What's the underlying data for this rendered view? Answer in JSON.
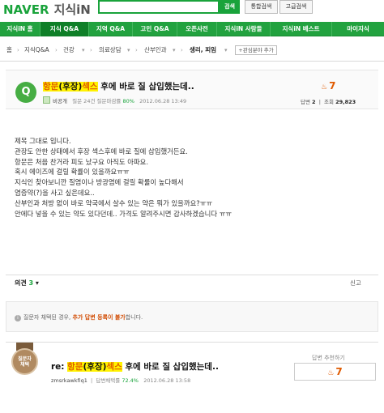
{
  "header": {
    "logo_naver": "NAVER",
    "logo_kin": "지식iN",
    "search_value": "",
    "search_button": "검색",
    "integrated_search": "통합검색",
    "advanced_search": "고급검색"
  },
  "nav": {
    "items": [
      {
        "label": "지식iN 홈"
      },
      {
        "label": "지식 Q&A"
      },
      {
        "label": "지역 Q&A"
      },
      {
        "label": "고민 Q&A"
      },
      {
        "label": "오픈사전"
      },
      {
        "label": "지식iN 사람들"
      },
      {
        "label": "지식iN 베스트"
      },
      {
        "label": "마이지식"
      }
    ],
    "active_index": 1
  },
  "breadcrumb": {
    "items": [
      "홈",
      "지식Q&A",
      "건강",
      "의료상담",
      "산부인과",
      "생리, 피임"
    ],
    "interest_button": "관심분야 추가"
  },
  "question": {
    "badge": "Q",
    "title_parts": [
      "항문",
      "(후장)",
      "섹스",
      " 후에 바로 질 삽입했는데.."
    ],
    "author": "비공개",
    "meta_prefix": "질문 24건 질문마감률",
    "close_rate": "80%",
    "date": "2012.06.28 13:49",
    "recommend_count": "7",
    "answers_label": "답변",
    "answers_count": "2",
    "views_label": "조회",
    "views_count": "29,823",
    "body_lines": [
      "제목 그대로 입니다.",
      "관장도 안한 상태에서 후장 섹스후에 바로 질에 삽입했거든요.",
      "항문은 처음 찬거라 피도 났구요 아직도 아파요.",
      "혹시 에이즈에 걸릴 확률이 있을까요ㅠㅠ",
      "지식인 찾아보니깐 질염이나 방광염에 걸릴 확률이 높다해서",
      "염증약(?)을 사고 싶은데요..",
      "산부인과 처방 없이 바로 약국에서 살수 있는 약은 뭐가 있을까요?ㅠㅠ",
      "안에다 넣을 수 있는 약도 있다던데.. 가격도 알려주시면 감사하겠습니다 ㅠㅠ"
    ]
  },
  "opinion": {
    "label": "의견",
    "count": "3",
    "report": "신고"
  },
  "notice": {
    "prefix": "질문자 채택된 경우,",
    "highlight": "추가 답변 등록이 불가",
    "suffix": "합니다."
  },
  "answer": {
    "medal_line1": "질문자",
    "medal_line2": "채택",
    "title_prefix": "re: ",
    "title_parts": [
      "항문",
      "(후장)",
      "섹스",
      " 후에 바로 질 삽입했는데.."
    ],
    "author": "zmsrkawkfiq1",
    "meta_prefix": "답변채택률",
    "rate": "72.4%",
    "date": "2012.06.28 13:58",
    "recommend_label": "답변 추천하기",
    "recommend_count": "7"
  },
  "colors": {
    "naver_green": "#19a33b",
    "nav_green": "#22a23f",
    "accent_orange": "#e05a00",
    "highlight_yellow": "#fff200"
  }
}
